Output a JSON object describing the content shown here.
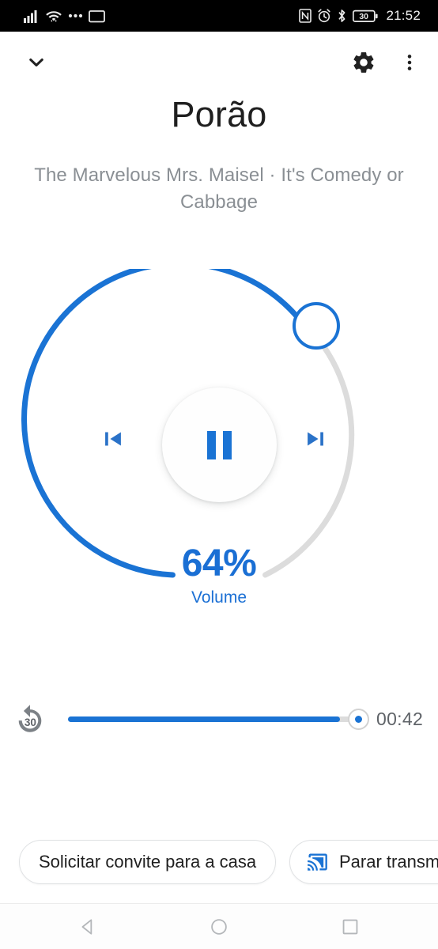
{
  "status_bar": {
    "icons_left": [
      "cellular-signal-icon",
      "wifi-icon",
      "more-dots-icon",
      "cast-screen-icon"
    ],
    "icons_right": [
      "nfc-icon",
      "alarm-icon",
      "bluetooth-icon",
      "battery-icon"
    ],
    "battery_level": "30",
    "time": "21:52"
  },
  "appbar": {
    "collapse_icon": "chevron-down-icon",
    "settings_icon": "gear-icon",
    "overflow_icon": "more-vert-icon"
  },
  "header": {
    "title": "Porão",
    "subtitle": "The Marvelous Mrs. Maisel · It's Comedy or Cabbage"
  },
  "volume_dial": {
    "percent_text": "64%",
    "percent_value": 64,
    "label": "Volume",
    "arc_color_active": "#1a73d4",
    "arc_color_track": "#dcdcdc",
    "thumb_icon": "slider-thumb-handle",
    "previous_icon": "skip-previous-icon",
    "play_pause_icon": "pause-icon",
    "next_icon": "skip-next-icon"
  },
  "seek": {
    "replay_icon": "replay-30-icon",
    "replay_seconds": "30",
    "progress_percent": 93,
    "elapsed_time": "00:42",
    "fill_color": "#1a73d4"
  },
  "chips": [
    {
      "label": "Solicitar convite para a casa",
      "icon": null
    },
    {
      "label": "Parar transmissão",
      "icon": "cast-connected-icon"
    }
  ],
  "nav_bar": {
    "back_icon": "back-triangle-icon",
    "home_icon": "home-circle-icon",
    "recents_icon": "recents-square-icon"
  }
}
